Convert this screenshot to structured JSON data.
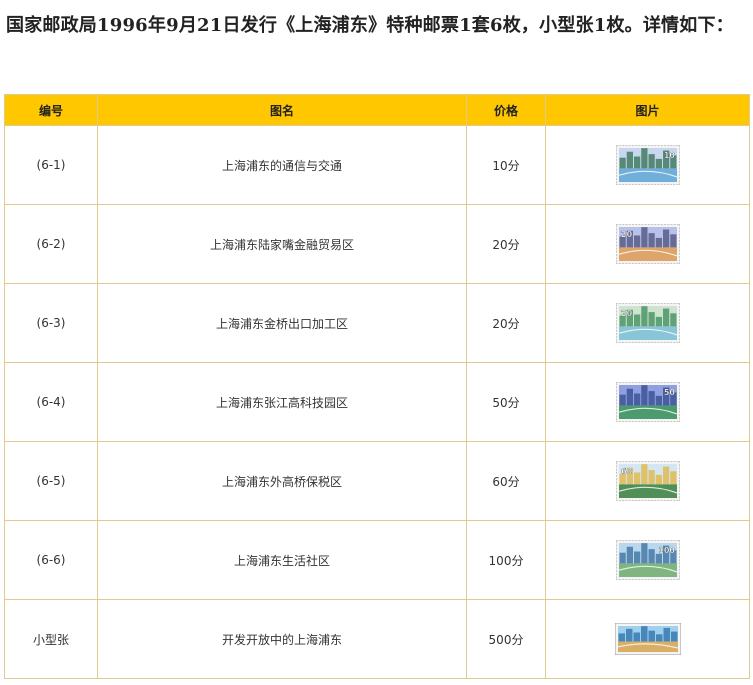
{
  "intro": "国家邮政局1996年9月21日发行《上海浦东》特种邮票1套6枚，小型张1枚。详情如下：",
  "table": {
    "headers": [
      "编号",
      "图名",
      "价格",
      "图片"
    ],
    "rows": [
      {
        "id": "(6-1)",
        "name": "上海浦东的通信与交通",
        "price": "10分",
        "face": "10",
        "palette": [
          "#c9d6f0",
          "#2f6f4e",
          "#5fa8d6"
        ],
        "face_pos": "right"
      },
      {
        "id": "(6-2)",
        "name": "上海浦东陆家嘴金融贸易区",
        "price": "20分",
        "face": "20",
        "palette": [
          "#b7c2ea",
          "#4b4f7a",
          "#e59f54"
        ],
        "face_pos": "left"
      },
      {
        "id": "(6-3)",
        "name": "上海浦东金桥出口加工区",
        "price": "20分",
        "face": "20",
        "palette": [
          "#cfe4cf",
          "#3b8c5a",
          "#7bc0d8"
        ],
        "face_pos": "left"
      },
      {
        "id": "(6-4)",
        "name": "上海浦东张江高科技园区",
        "price": "50分",
        "face": "50",
        "palette": [
          "#8f9fe0",
          "#314a8c",
          "#3f9a5a"
        ],
        "face_pos": "right"
      },
      {
        "id": "(6-5)",
        "name": "上海浦东外高桥保税区",
        "price": "60分",
        "face": "60",
        "palette": [
          "#d5e6f3",
          "#e0b43a",
          "#3a7f3d"
        ],
        "face_pos": "left"
      },
      {
        "id": "(6-6)",
        "name": "上海浦东生活社区",
        "price": "100分",
        "face": "100",
        "palette": [
          "#b9d8ee",
          "#386d9e",
          "#74b06c"
        ],
        "face_pos": "right"
      },
      {
        "id": "小型张",
        "name": "开发开放中的上海浦东",
        "price": "500分",
        "face": "",
        "palette": [
          "#9fd0ee",
          "#2c6fa8",
          "#e3a94d"
        ],
        "face_pos": "none"
      }
    ]
  }
}
